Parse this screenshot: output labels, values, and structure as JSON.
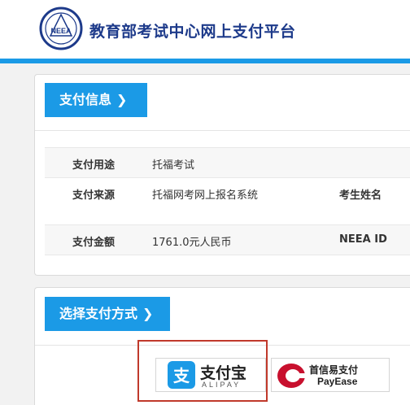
{
  "header": {
    "title": "教育部考试中心网上支付平台",
    "logo_text": "NEEA",
    "accent_color": "#1b9ae6"
  },
  "payment_info": {
    "section_label": "支付信息",
    "rows": [
      {
        "label": "支付用途",
        "value": "托福考试"
      },
      {
        "label": "支付来源",
        "value": "托福网考网上报名系统",
        "label2": "考生姓名"
      },
      {
        "label": "支付金额",
        "value": "1761.0元人民币",
        "label2": "NEEA ID"
      }
    ]
  },
  "payment_method": {
    "section_label": "选择支付方式",
    "options": [
      {
        "brand": "支付宝",
        "sub": "ALIPAY",
        "icon": "alipay-icon",
        "selected": true
      },
      {
        "brand": "首信易支付",
        "sub": "PayEase",
        "icon": "payease-icon",
        "selected": false
      }
    ]
  }
}
